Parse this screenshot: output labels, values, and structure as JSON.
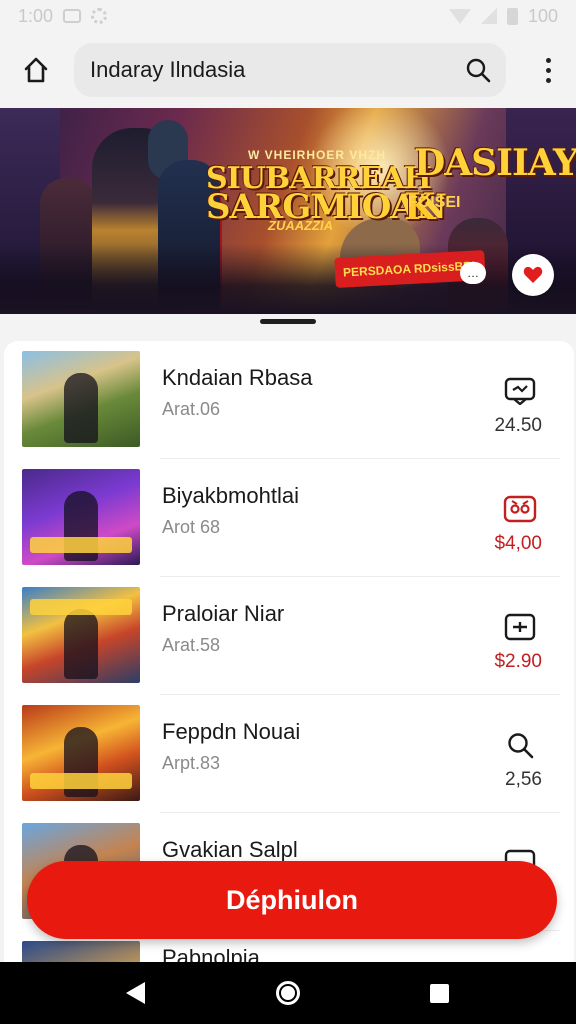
{
  "status_bar": {
    "time": "1:00",
    "battery": "100"
  },
  "app_bar": {
    "search_text": "Indaray Ilndasia"
  },
  "banner": {
    "title_line1": "SIUBARREAH",
    "title_line2": "SARGMIOAN",
    "title_line3": "DASIIAY",
    "title_line4": "K",
    "kicker": "W VHEIRHOER VHZH",
    "small_text": "ZUAAZZIA",
    "side_text": "FOISEI",
    "ribbon_text": "PERSDAOA RDsissBRI",
    "tag": "…"
  },
  "list": [
    {
      "title": "Kndaian Rbasa",
      "subtitle": "Arat.06",
      "price": "24.50",
      "price_color": "#333333",
      "action_icon": "message-icon"
    },
    {
      "title": "Biyakbmohtlai",
      "subtitle": "Arot 68",
      "price": "$4,00",
      "price_color": "#c21f1f",
      "action_icon": "gamepad-icon"
    },
    {
      "title": "Praloiar Niar",
      "subtitle": "Arat.58",
      "price": "$2.90",
      "price_color": "#c21f1f",
      "action_icon": "add-box-icon"
    },
    {
      "title": "Feppdn Nouai",
      "subtitle": "Arpt.83",
      "price": "2,56",
      "price_color": "#333333",
      "action_icon": "search-icon"
    },
    {
      "title": "Gvakian Salpl",
      "subtitle": "",
      "price": "",
      "price_color": "#333333",
      "action_icon": "message-icon"
    },
    {
      "title": "Pabnolpia",
      "subtitle": "",
      "price": "",
      "price_color": "#333333",
      "action_icon": ""
    }
  ],
  "cta": {
    "label": "Déphiulon"
  },
  "colors": {
    "accent": "#e8190f",
    "price_red": "#c21f1f",
    "background": "#f3f3f3"
  }
}
